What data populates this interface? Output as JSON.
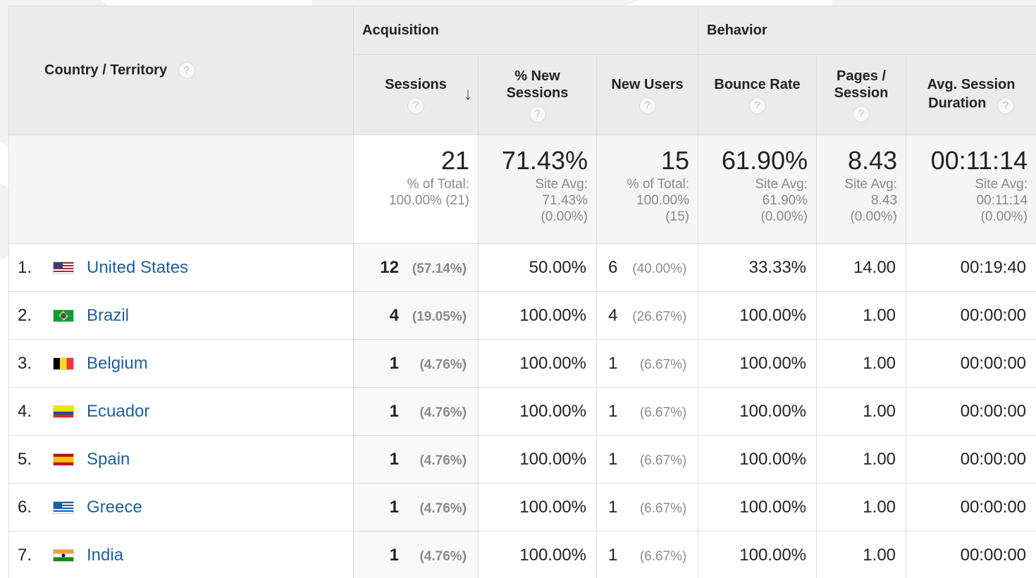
{
  "header": {
    "country_label": "Country / Territory",
    "acquisition_label": "Acquisition",
    "behavior_label": "Behavior",
    "help_glyph": "?",
    "sort_glyph": "↓",
    "columns": {
      "sessions": "Sessions",
      "pct_new_line1": "% New",
      "pct_new_line2": "Sessions",
      "new_users": "New Users",
      "bounce_rate": "Bounce Rate",
      "pages_line1": "Pages /",
      "pages_line2": "Session",
      "avg_line1": "Avg. Session",
      "avg_line2": "Duration"
    }
  },
  "totals": {
    "sessions": {
      "value": "21",
      "label": "% of Total:",
      "detail": "100.00% (21)"
    },
    "pct_new": {
      "value": "71.43%",
      "label": "Site Avg:",
      "avg": "71.43%",
      "delta": "(0.00%)"
    },
    "new_users": {
      "value": "15",
      "label": "% of Total:",
      "pct": "100.00%",
      "detail": "(15)"
    },
    "bounce_rate": {
      "value": "61.90%",
      "label": "Site Avg:",
      "avg": "61.90%",
      "delta": "(0.00%)"
    },
    "pages": {
      "value": "8.43",
      "label": "Site Avg:",
      "avg": "8.43",
      "delta": "(0.00%)"
    },
    "duration": {
      "value": "00:11:14",
      "label": "Site Avg:",
      "avg": "00:11:14",
      "delta": "(0.00%)"
    }
  },
  "rows": [
    {
      "index": "1.",
      "flag": "us-flag-icon",
      "country": "United States",
      "sessions": "12",
      "sessions_pct": "(57.14%)",
      "pct_new": "50.00%",
      "new_users": "6",
      "new_users_pct": "(40.00%)",
      "bounce": "33.33%",
      "pages": "14.00",
      "duration": "00:19:40"
    },
    {
      "index": "2.",
      "flag": "brazil-flag-icon",
      "country": "Brazil",
      "sessions": "4",
      "sessions_pct": "(19.05%)",
      "pct_new": "100.00%",
      "new_users": "4",
      "new_users_pct": "(26.67%)",
      "bounce": "100.00%",
      "pages": "1.00",
      "duration": "00:00:00"
    },
    {
      "index": "3.",
      "flag": "belgium-flag-icon",
      "country": "Belgium",
      "sessions": "1",
      "sessions_pct": "(4.76%)",
      "pct_new": "100.00%",
      "new_users": "1",
      "new_users_pct": "(6.67%)",
      "bounce": "100.00%",
      "pages": "1.00",
      "duration": "00:00:00"
    },
    {
      "index": "4.",
      "flag": "ecuador-flag-icon",
      "country": "Ecuador",
      "sessions": "1",
      "sessions_pct": "(4.76%)",
      "pct_new": "100.00%",
      "new_users": "1",
      "new_users_pct": "(6.67%)",
      "bounce": "100.00%",
      "pages": "1.00",
      "duration": "00:00:00"
    },
    {
      "index": "5.",
      "flag": "spain-flag-icon",
      "country": "Spain",
      "sessions": "1",
      "sessions_pct": "(4.76%)",
      "pct_new": "100.00%",
      "new_users": "1",
      "new_users_pct": "(6.67%)",
      "bounce": "100.00%",
      "pages": "1.00",
      "duration": "00:00:00"
    },
    {
      "index": "6.",
      "flag": "greece-flag-icon",
      "country": "Greece",
      "sessions": "1",
      "sessions_pct": "(4.76%)",
      "pct_new": "100.00%",
      "new_users": "1",
      "new_users_pct": "(6.67%)",
      "bounce": "100.00%",
      "pages": "1.00",
      "duration": "00:00:00"
    },
    {
      "index": "7.",
      "flag": "india-flag-icon",
      "country": "India",
      "sessions": "1",
      "sessions_pct": "(4.76%)",
      "pct_new": "100.00%",
      "new_users": "1",
      "new_users_pct": "(6.67%)",
      "bounce": "100.00%",
      "pages": "1.00",
      "duration": "00:00:00"
    }
  ],
  "colors": {
    "link": "#1f5f99",
    "header_bg": "#ebebeb",
    "muted_text": "#8a8a8a"
  }
}
